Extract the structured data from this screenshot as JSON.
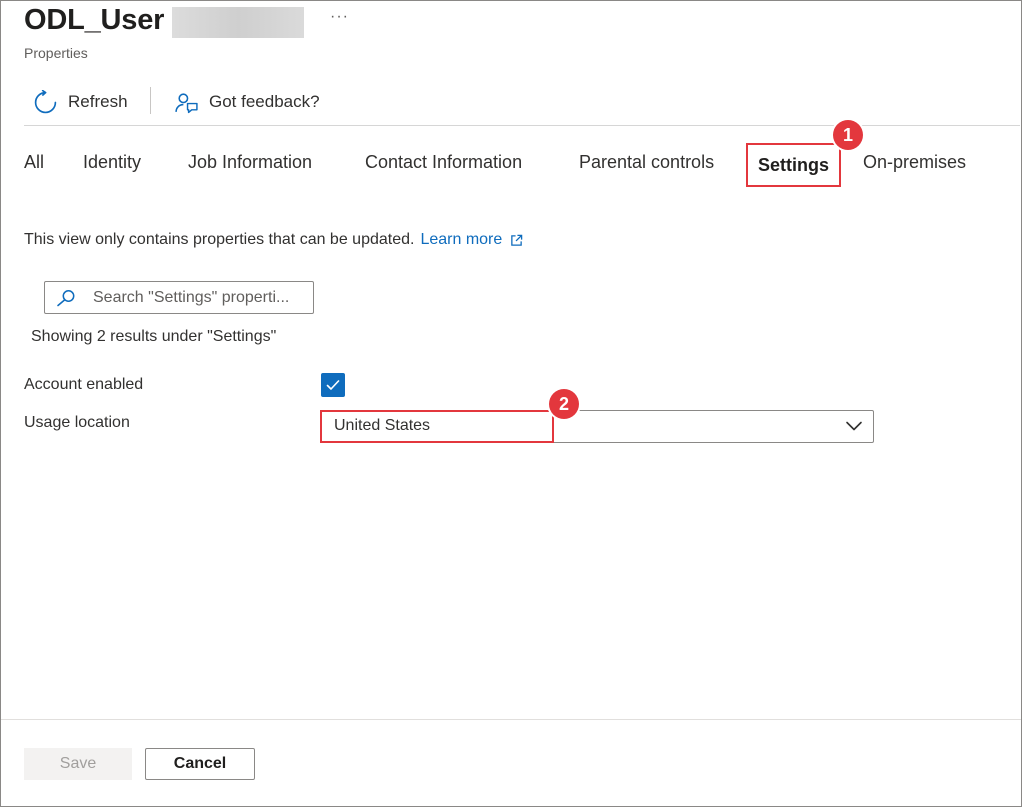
{
  "header": {
    "title": "ODL_User",
    "more_label": "···",
    "subtitle": "Properties"
  },
  "commands": {
    "refresh_label": "Refresh",
    "feedback_label": "Got feedback?"
  },
  "tabs": [
    {
      "label": "All"
    },
    {
      "label": "Identity"
    },
    {
      "label": "Job Information"
    },
    {
      "label": "Contact Information"
    },
    {
      "label": "Parental controls"
    },
    {
      "label": "Settings",
      "selected": true
    },
    {
      "label": "On-premises"
    }
  ],
  "annotations": {
    "badge1": "1",
    "badge2": "2"
  },
  "info": {
    "text": "This view only contains properties that can be updated.",
    "link": "Learn more"
  },
  "search": {
    "placeholder": "Search \"Settings\" properti..."
  },
  "results_text": "Showing 2 results under \"Settings\"",
  "fields": {
    "account_enabled_label": "Account enabled",
    "account_enabled_checked": true,
    "usage_location_label": "Usage location",
    "usage_location_value": "United States"
  },
  "footer": {
    "save_label": "Save",
    "cancel_label": "Cancel"
  },
  "colors": {
    "accent": "#0f6cbd",
    "highlight": "#e3373d"
  },
  "icons": {
    "refresh": "refresh-icon",
    "feedback": "feedback-icon",
    "external": "external-link-icon",
    "search": "search-icon",
    "check": "checkmark-icon",
    "chevron": "chevron-down-icon"
  }
}
